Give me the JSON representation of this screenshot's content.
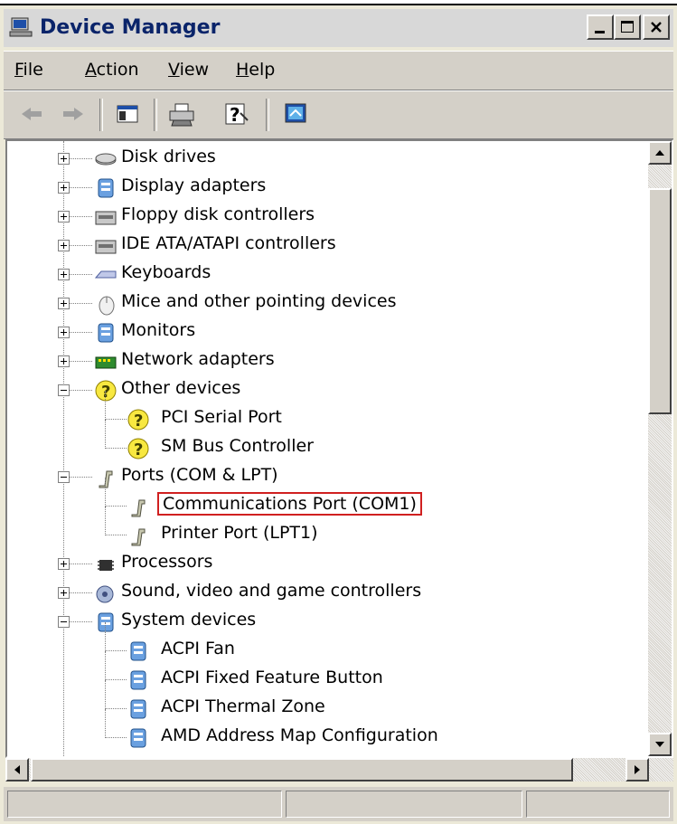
{
  "window": {
    "title": "Device Manager",
    "caption_buttons": [
      "minimize",
      "maximize",
      "close"
    ]
  },
  "menu": [
    {
      "label": "File",
      "accel": "F",
      "rest": "ile"
    },
    {
      "label": "Action",
      "accel": "A",
      "rest": "ction"
    },
    {
      "label": "View",
      "accel": "V",
      "rest": "iew"
    },
    {
      "label": "Help",
      "accel": "H",
      "rest": "elp"
    }
  ],
  "toolbar": {
    "buttons": [
      "back-arrow-icon",
      "forward-arrow-icon",
      "show-hide-console-tree-icon",
      "print-icon",
      "help-icon",
      "scan-hardware-icon"
    ]
  },
  "tree": {
    "items": [
      {
        "label": "Disk drives",
        "icon": "disk-drive-icon",
        "level": 0,
        "expanded": false
      },
      {
        "label": "Display adapters",
        "icon": "display-adapter-icon",
        "level": 0,
        "expanded": false
      },
      {
        "label": "Floppy disk controllers",
        "icon": "floppy-controller-icon",
        "level": 0,
        "expanded": false
      },
      {
        "label": "IDE ATA/ATAPI controllers",
        "icon": "ide-controller-icon",
        "level": 0,
        "expanded": false
      },
      {
        "label": "Keyboards",
        "icon": "keyboard-icon",
        "level": 0,
        "expanded": false
      },
      {
        "label": "Mice and other pointing devices",
        "icon": "mouse-icon",
        "level": 0,
        "expanded": false
      },
      {
        "label": "Monitors",
        "icon": "monitor-icon",
        "level": 0,
        "expanded": false
      },
      {
        "label": "Network adapters",
        "icon": "network-adapter-icon",
        "level": 0,
        "expanded": false
      },
      {
        "label": "Other devices",
        "icon": "unknown-device-icon",
        "level": 0,
        "expanded": true
      },
      {
        "label": "PCI Serial Port",
        "icon": "unknown-device-icon",
        "level": 1
      },
      {
        "label": "SM Bus Controller",
        "icon": "unknown-device-icon",
        "level": 1
      },
      {
        "label": "Ports (COM & LPT)",
        "icon": "port-icon",
        "level": 0,
        "expanded": true
      },
      {
        "label": "Communications Port (COM1)",
        "icon": "port-icon",
        "level": 1,
        "highlighted": true
      },
      {
        "label": "Printer Port (LPT1)",
        "icon": "port-icon",
        "level": 1
      },
      {
        "label": "Processors",
        "icon": "processor-icon",
        "level": 0,
        "expanded": false
      },
      {
        "label": "Sound, video and game controllers",
        "icon": "sound-icon",
        "level": 0,
        "expanded": false
      },
      {
        "label": "System devices",
        "icon": "system-device-icon",
        "level": 0,
        "expanded": true
      },
      {
        "label": "ACPI Fan",
        "icon": "system-device-icon",
        "level": 1
      },
      {
        "label": "ACPI Fixed Feature Button",
        "icon": "system-device-icon",
        "level": 1
      },
      {
        "label": "ACPI Thermal Zone",
        "icon": "system-device-icon",
        "level": 1
      },
      {
        "label": "AMD Address Map Configuration",
        "icon": "system-device-icon",
        "level": 1
      }
    ]
  },
  "colors": {
    "title_text": "#0a246a",
    "face": "#d4d0c8",
    "highlight_border": "#d02020"
  }
}
